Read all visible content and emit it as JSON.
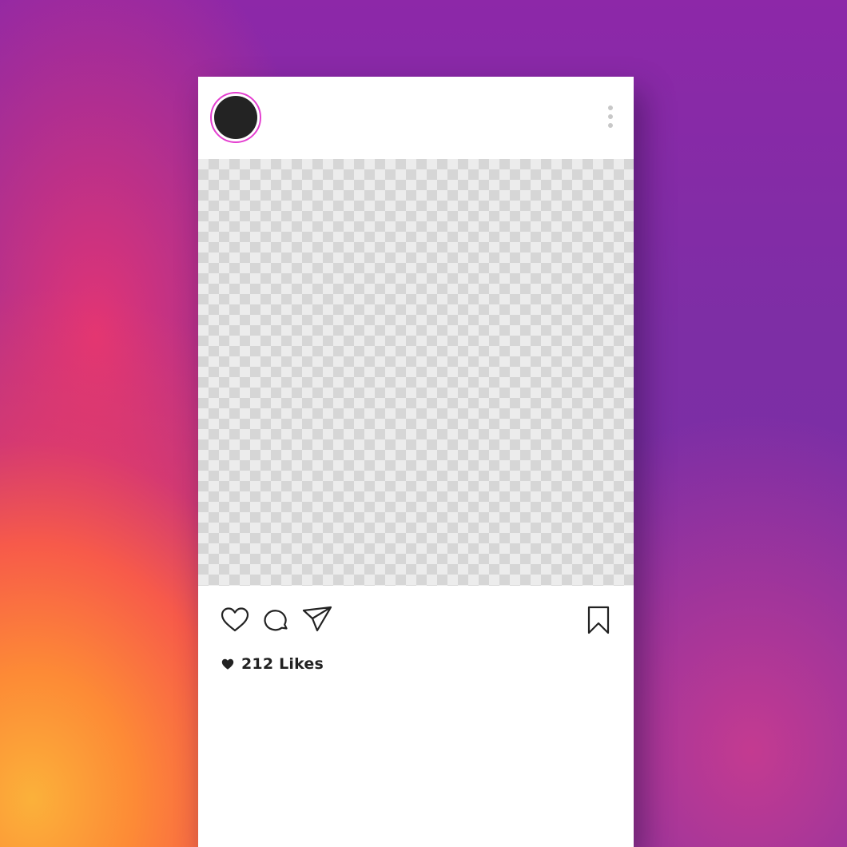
{
  "post": {
    "likes_label": "212 Likes",
    "icons": {
      "like": "heart-icon",
      "comment": "comment-icon",
      "share": "send-icon",
      "save": "bookmark-icon",
      "more": "more-vertical-icon",
      "likes": "heart-filled-icon"
    }
  },
  "colors": {
    "avatar_ring": "#e43fd0",
    "avatar_fill": "#232323",
    "icon_stroke": "#222222",
    "card_background": "#ffffff"
  }
}
